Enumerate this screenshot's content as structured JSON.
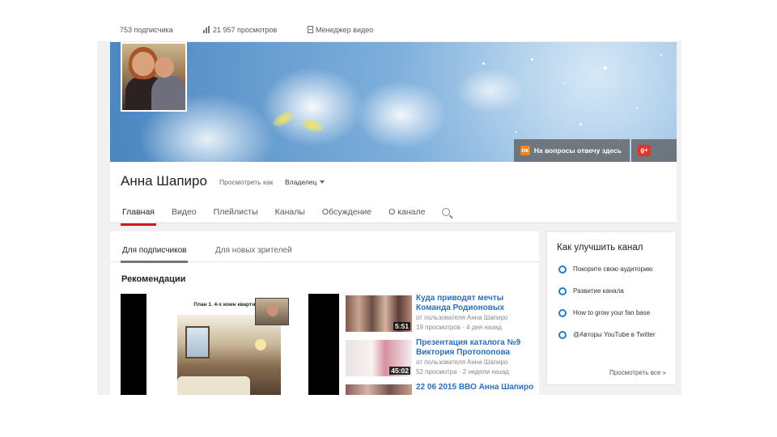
{
  "stats": {
    "subscribers": "753 подписчика",
    "views": "21 957 просмотров",
    "video_manager": "Менеджер видео"
  },
  "banner": {
    "ok_link": "На вопросы отвечу здесь",
    "gplus_label": "g+"
  },
  "channel": {
    "name": "Анна Шапиро",
    "view_as_label": "Просмотреть как",
    "view_as_value": "Владелец",
    "tabs": [
      "Главная",
      "Видео",
      "Плейлисты",
      "Каналы",
      "Обсуждение",
      "О канале"
    ],
    "active_tab": "Главная"
  },
  "main": {
    "subtabs": [
      "Для подписчиков",
      "Для новых зрителей"
    ],
    "recommendations_title": "Рекомендации",
    "player": {
      "slide_title": "План 1. 4-х комн квартира"
    },
    "videos": [
      {
        "title": "Куда приводят мечты Команда Родионовых",
        "author": "от пользователя Анна Шапиро",
        "meta": "19 просмотров · 4 дня назад",
        "duration": "5:51"
      },
      {
        "title": "Презентация каталога №9 Виктория Протопопова",
        "author": "от пользователя Анна Шапиро",
        "meta": "52 просмотра · 2 недели назад",
        "duration": "45:02"
      },
      {
        "title": "22 06 2015 ВВО Анна Шапиро",
        "author": "",
        "meta": "",
        "duration": ""
      }
    ]
  },
  "sidebar": {
    "title": "Как улучшить канал",
    "tips": [
      "Покорите свою аудиторию",
      "Развитие канала",
      "How to grow your fan base",
      "@Авторы YouTube в Twitter"
    ],
    "more": "Просмотреть все »"
  },
  "colors": {
    "accent_red": "#cc181e",
    "link_blue": "#2a6fb8",
    "tip_ring_blue": "#1f80c6"
  }
}
